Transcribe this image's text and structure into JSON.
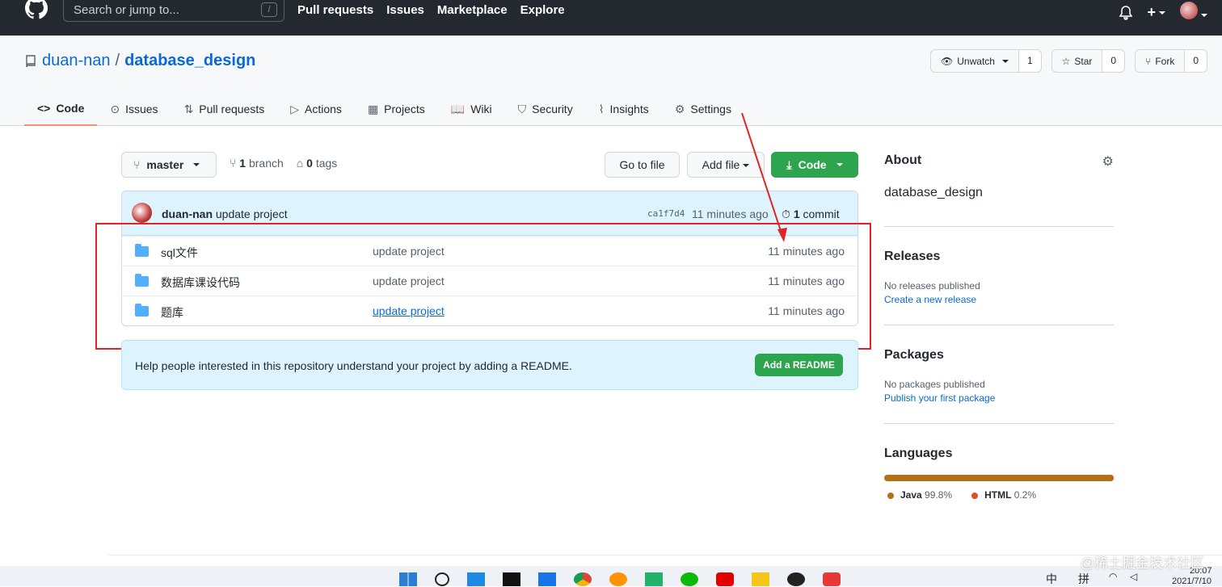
{
  "header": {
    "search_placeholder": "Search or jump to...",
    "slash_hint": "/",
    "nav": [
      "Pull requests",
      "Issues",
      "Marketplace",
      "Explore"
    ],
    "plus": "+"
  },
  "repo": {
    "owner": "duan-nan",
    "separator": "/",
    "name": "database_design",
    "watch_label": "Unwatch",
    "watch_count": "1",
    "star_label": "Star",
    "star_count": "0",
    "fork_label": "Fork",
    "fork_count": "0"
  },
  "tabs": [
    {
      "label": "Code",
      "icon": "<>"
    },
    {
      "label": "Issues",
      "icon": "⊙"
    },
    {
      "label": "Pull requests",
      "icon": "⇅"
    },
    {
      "label": "Actions",
      "icon": "▷"
    },
    {
      "label": "Projects",
      "icon": "▦"
    },
    {
      "label": "Wiki",
      "icon": "📖"
    },
    {
      "label": "Security",
      "icon": "⛉"
    },
    {
      "label": "Insights",
      "icon": "⌇"
    },
    {
      "label": "Settings",
      "icon": "⚙"
    }
  ],
  "toolbar": {
    "branch": "master",
    "branch_count": "1",
    "branch_word": "branch",
    "tag_count": "0",
    "tag_word": "tags",
    "go_to_file": "Go to file",
    "add_file": "Add file",
    "code": "Code"
  },
  "commit": {
    "author": "duan-nan",
    "message": "update project",
    "sha": "ca1f7d4",
    "time": "11 minutes ago",
    "count": "1",
    "count_word": "commit"
  },
  "files": [
    {
      "name": "sql文件",
      "message": "update project",
      "age": "11 minutes ago"
    },
    {
      "name": "数据库课设代码",
      "message": "update project",
      "age": "11 minutes ago"
    },
    {
      "name": "题库",
      "message": "update project",
      "age": "11 minutes ago"
    }
  ],
  "readme": {
    "text": "Help people interested in this repository understand your project by adding a README.",
    "button": "Add a README"
  },
  "sidebar": {
    "about_title": "About",
    "about_desc": "database_design",
    "releases_title": "Releases",
    "releases_none": "No releases published",
    "releases_link": "Create a new release",
    "packages_title": "Packages",
    "packages_none": "No packages published",
    "packages_link": "Publish your first package",
    "languages_title": "Languages",
    "languages": [
      {
        "name": "Java",
        "percent": "99.8%",
        "color": "#b07219"
      },
      {
        "name": "HTML",
        "percent": "0.2%",
        "color": "#e34c26"
      }
    ]
  },
  "watermark": "@稀土掘金技术社区",
  "clock": {
    "time": "20:07",
    "date": "2021/7/10"
  },
  "ime": {
    "lang": "中",
    "mode": "拼"
  }
}
